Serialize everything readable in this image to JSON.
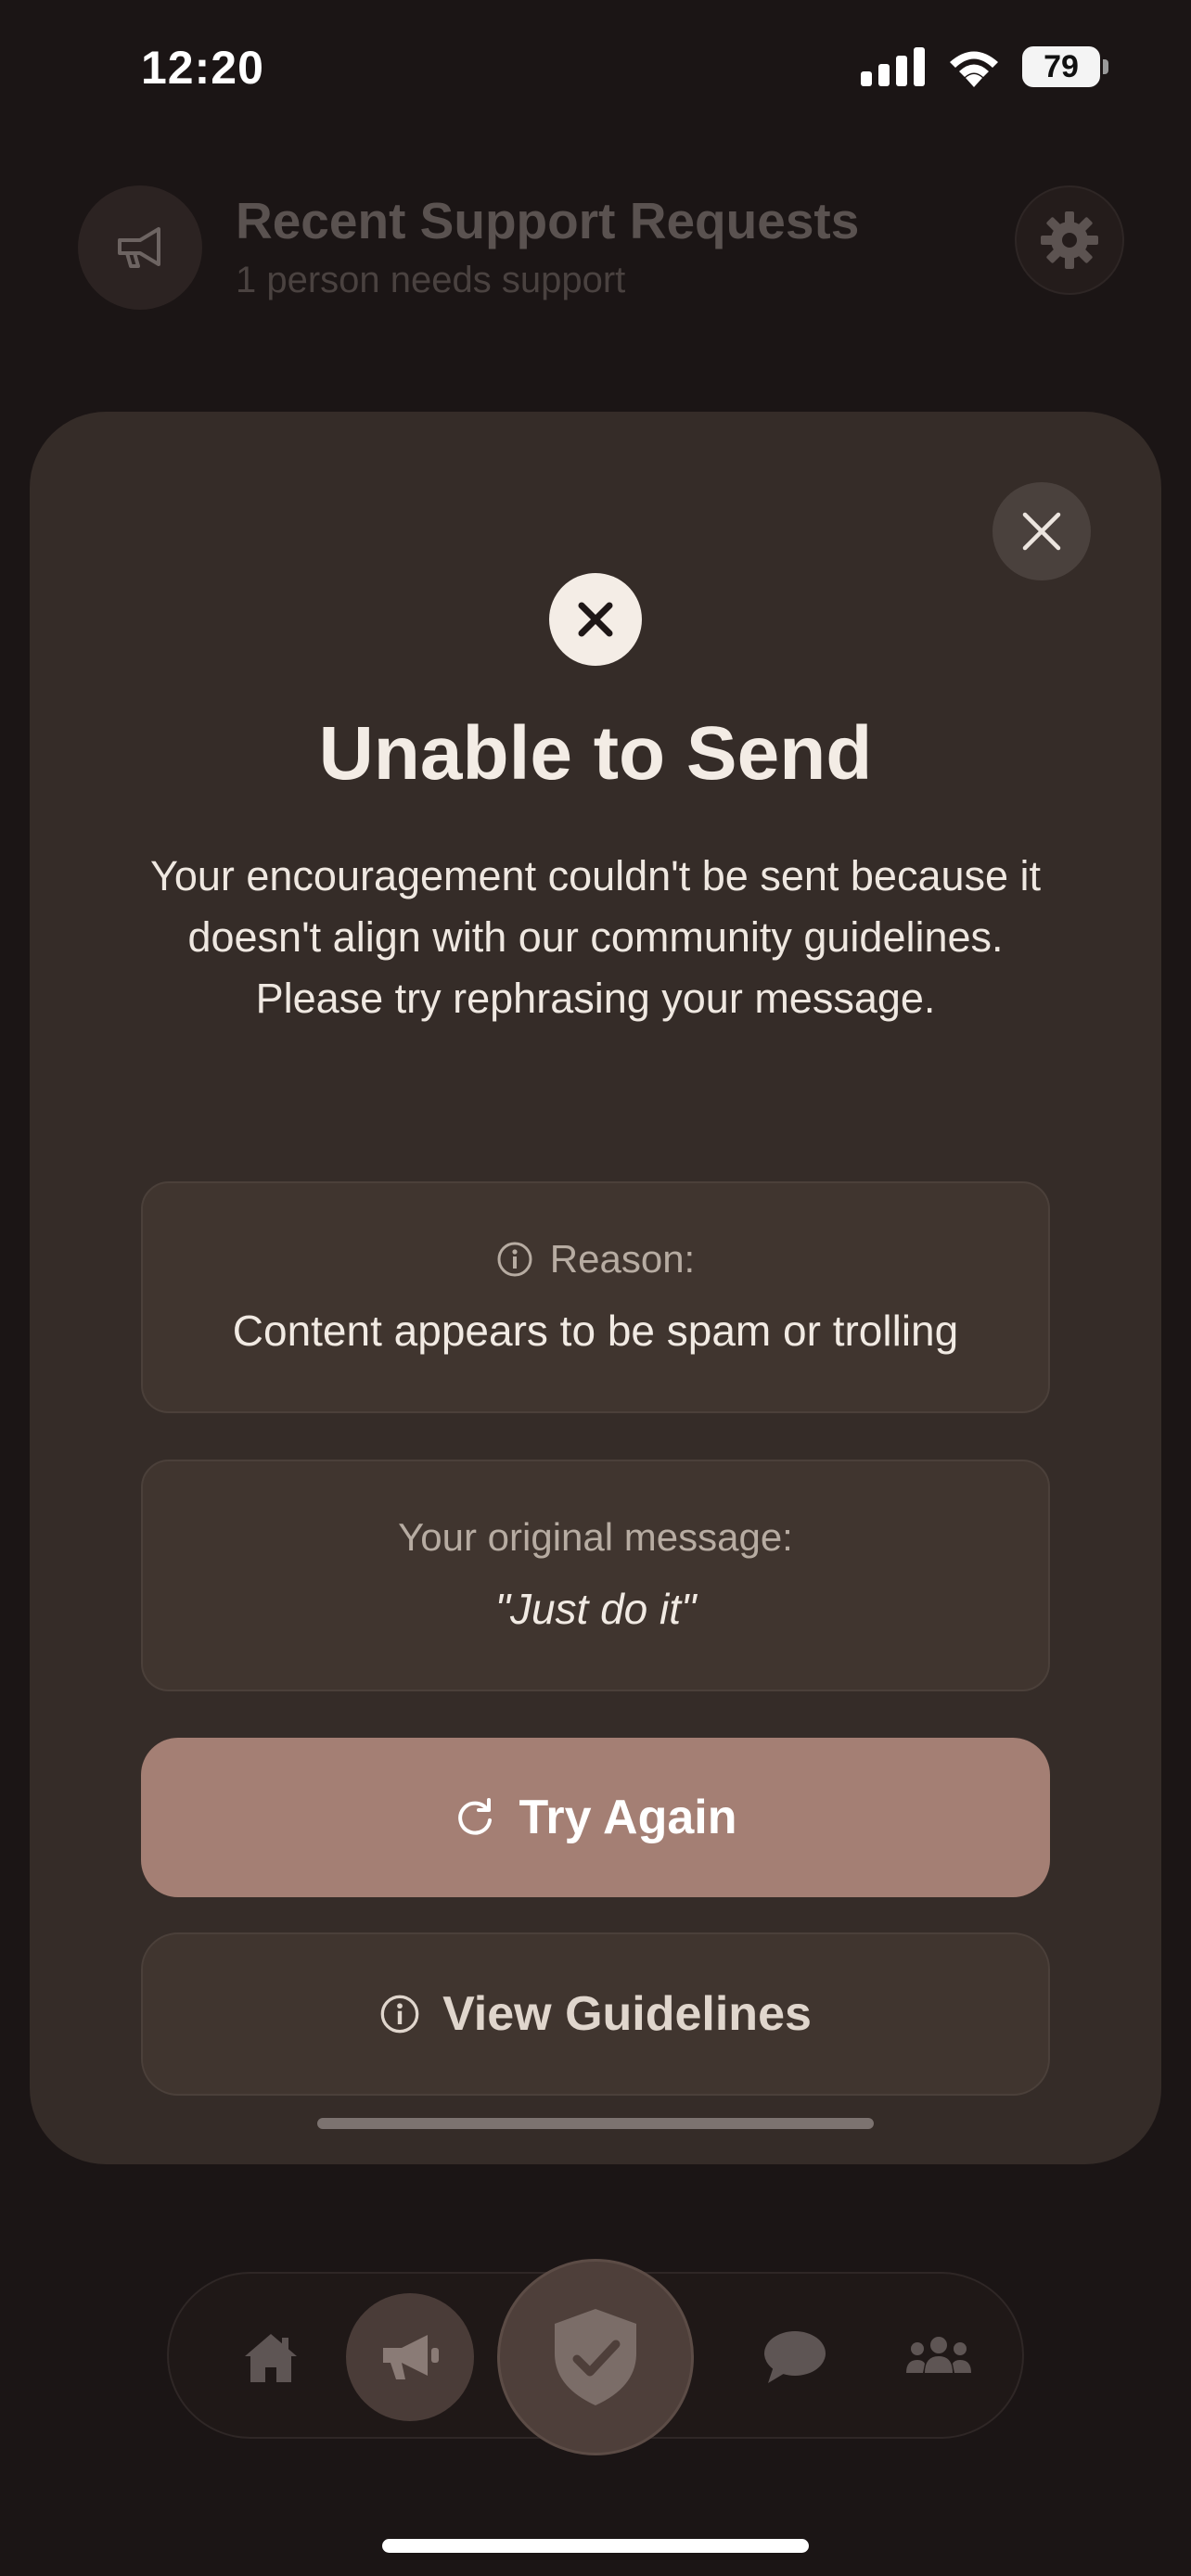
{
  "status_bar": {
    "time": "12:20",
    "battery": "79"
  },
  "header": {
    "title": "Recent Support Requests",
    "subtitle": "1 person needs support"
  },
  "modal": {
    "title": "Unable to Send",
    "body": "Your encouragement couldn't be sent because it doesn't align with our community guidelines. Please try rephrasing your message.",
    "reason_label": "Reason:",
    "reason_value": "Content appears to be spam or trolling",
    "original_label": "Your original message:",
    "original_value": "\"Just do it\"",
    "try_again_label": "Try Again",
    "view_guidelines_label": "View Guidelines"
  },
  "nav": {
    "items": [
      "home-icon",
      "megaphone-icon",
      "shield-check-icon",
      "chat-bubble-icon",
      "community-icon"
    ],
    "active": "shield-check-icon"
  },
  "colors": {
    "accent": "#a47f74",
    "sheet": "#352c28",
    "background": "#1b1515"
  }
}
